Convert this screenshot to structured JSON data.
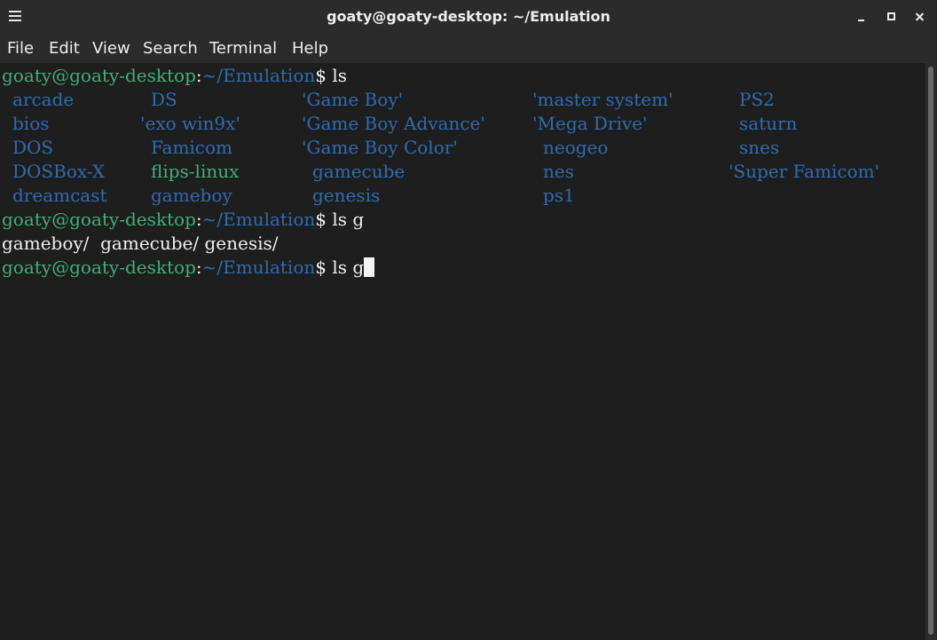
{
  "window": {
    "title": "goaty@goaty-desktop: ~/Emulation"
  },
  "menu": {
    "file": "File",
    "edit": "Edit",
    "view": "View",
    "search": "Search",
    "terminal": "Terminal",
    "help": "Help"
  },
  "prompt": {
    "user_host": "goaty@goaty-desktop",
    "colon": ":",
    "path": "~/Emulation",
    "dollar": "$"
  },
  "commands": {
    "first": " ls",
    "second": " ls g",
    "current": " ls g"
  },
  "ls_output": {
    "col1": [
      "arcade",
      "bios",
      "DOS",
      "DOSBox-X",
      "dreamcast"
    ],
    "col2": [
      "DS",
      "'exo win9x'",
      "Famicom",
      "flips-linux",
      "gameboy"
    ],
    "col3": [
      "'Game Boy'",
      "'Game Boy Advance'",
      "'Game Boy Color'",
      "gamecube",
      "genesis"
    ],
    "col4": [
      "'master system'",
      "'Mega Drive'",
      "neogeo",
      "nes",
      "ps1"
    ],
    "col5": [
      "PS2",
      "saturn",
      "snes",
      "'Super Famicom'"
    ]
  },
  "completion_output": "gameboy/  gamecube/ genesis/",
  "colors": {
    "prompt_user": "#3fae7c",
    "directory": "#2f6bb0",
    "executable": "#3fae7c",
    "background": "#1e1e1e",
    "chrome": "#2b2b2b"
  },
  "icons": {
    "menu": "hamburger-icon",
    "minimize": "minimize-icon",
    "maximize": "maximize-icon",
    "close": "close-icon"
  }
}
